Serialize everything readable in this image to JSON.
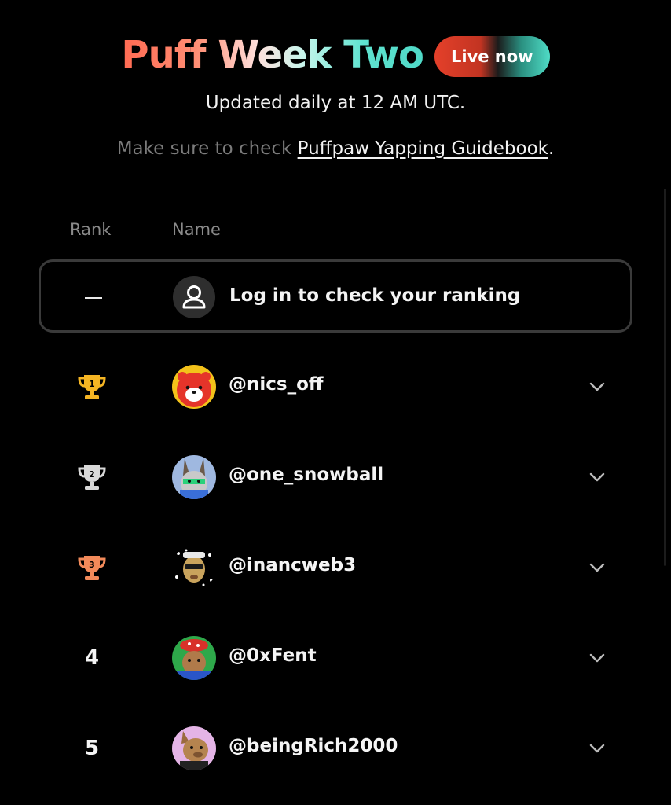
{
  "header": {
    "title": "Puff Week Two",
    "badge": "Live now",
    "subtitle": "Updated daily at 12 AM UTC.",
    "guide_prefix": "Make sure to check ",
    "guide_link": "Puffpaw Yapping Guidebook",
    "guide_suffix": "."
  },
  "table": {
    "columns": {
      "rank": "Rank",
      "name": "Name"
    },
    "login_row": {
      "rank": "—",
      "text": "Log in to check your ranking",
      "icon": "user-icon"
    },
    "rows": [
      {
        "rank": "1",
        "rank_icon": "gold-trophy-icon",
        "handle": "@nics_off"
      },
      {
        "rank": "2",
        "rank_icon": "silver-trophy-icon",
        "handle": "@one_snowball"
      },
      {
        "rank": "3",
        "rank_icon": "bronze-trophy-icon",
        "handle": "@inancweb3"
      },
      {
        "rank": "4",
        "rank_icon": null,
        "handle": "@0xFent"
      },
      {
        "rank": "5",
        "rank_icon": null,
        "handle": "@beingRich2000"
      }
    ]
  },
  "colors": {
    "background": "#000000",
    "gold": "#f5b523",
    "silver": "#d9d9d9",
    "bronze": "#f28a5a",
    "accent_red": "#e4402a",
    "accent_teal": "#4fdcc6"
  }
}
